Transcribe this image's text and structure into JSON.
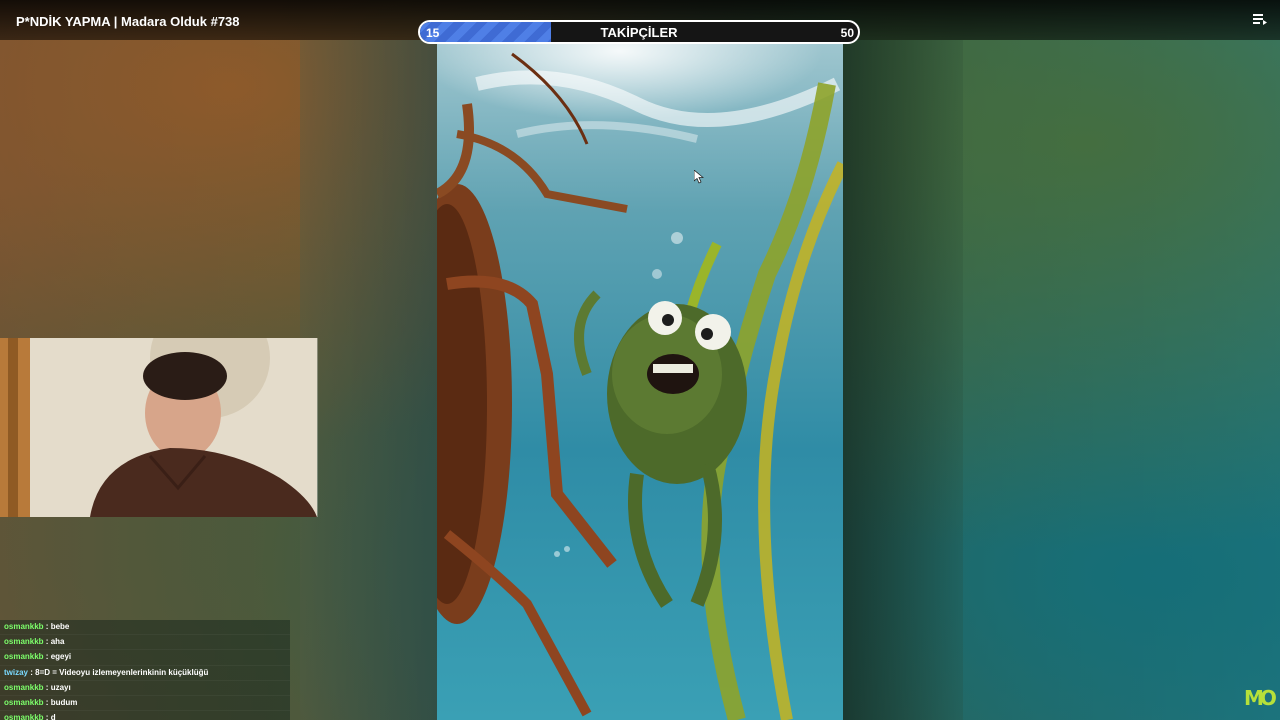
{
  "video": {
    "title": "P*NDİK YAPMA | Madara Olduk #738"
  },
  "follower_goal": {
    "current": "15",
    "label": "TAKİPÇİLER",
    "goal": "50",
    "progress_fraction": 0.3,
    "fill_color": "#4f7fe6"
  },
  "chat": {
    "messages": [
      {
        "user": "osmankkb",
        "text": "bebe"
      },
      {
        "user": "osmankkb",
        "text": "aha"
      },
      {
        "user": "osmankkb",
        "text": "egeyi"
      },
      {
        "user": "twizay",
        "text": "8=D = Videoyu izlemeyenlerinkinin küçüklüğü"
      },
      {
        "user": "osmankkb",
        "text": "uzayı"
      },
      {
        "user": "osmankkb",
        "text": "budum"
      },
      {
        "user": "osmankkb",
        "text": "d"
      }
    ]
  },
  "channel_logo": {
    "text": "MO",
    "color": "#b6e03a"
  },
  "icons": {
    "menu": "playlist-menu-icon",
    "cursor": "mouse-pointer-icon"
  }
}
